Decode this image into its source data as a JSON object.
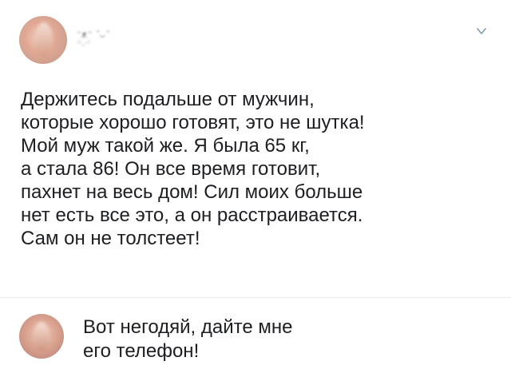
{
  "post": {
    "author_name": "ᵔᴥᵔ ˘ᴗ˘",
    "author_handle": "ꜝ˘ᵕ˘ꜝ",
    "menu_icon": "chevron-down-icon",
    "text": "Держитесь подальше от мужчин,\nкоторые хорошо готовят, это не шутка!\nМой муж такой же. Я была 65 кг,\nа стала 86! Он все время готовит,\nпахнет на весь дом! Сил моих больше\nнет есть все это, а он расстраивается.\nСам он не толстеет!"
  },
  "reply": {
    "text": "Вот негодяй, дайте мне\nего телефон!"
  },
  "colors": {
    "text": "#1c1e21",
    "muted": "#8a8d91",
    "divider": "#e6ecf0",
    "icon": "#8899a6"
  }
}
